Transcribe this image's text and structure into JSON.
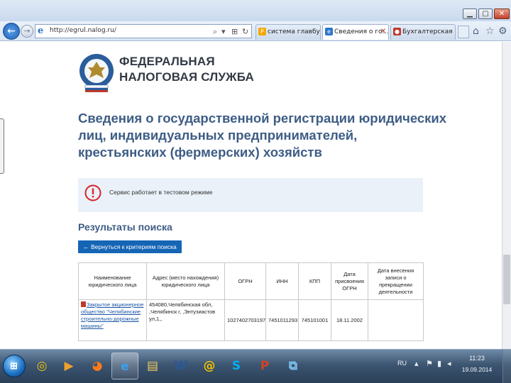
{
  "browser": {
    "window_buttons": {
      "minimize": "▁",
      "maximize": "▢",
      "close": "✕"
    },
    "back_icon": "←",
    "forward_icon": "→",
    "url": "http://egrul.nalog.ru/",
    "address_icons": {
      "search": "⌕",
      "dropdown": "▾",
      "compat": "⊞",
      "refresh": "↻"
    },
    "tabs": [
      {
        "label": "система главбух ...",
        "fav": "P",
        "fav_color": "#f2a900"
      },
      {
        "label": "Сведения о го...",
        "fav": "e",
        "fav_color": "#2a75c9",
        "close": "✕"
      },
      {
        "label": "Бухгалтерская сп...",
        "fav": "●",
        "fav_color": "#c0392b"
      }
    ],
    "command_icons": {
      "home": "⌂",
      "favorites": "☆",
      "tools": "⚙"
    }
  },
  "page": {
    "logo": {
      "line1": "ФЕДЕРАЛЬНАЯ",
      "line2": "НАЛОГОВАЯ СЛУЖБА"
    },
    "title": "Сведения о государственной регистрации юридических лиц, индивидуальных предпринимателей, крестьянских (фермерских) хозяйств",
    "notice": {
      "icon": "!",
      "text": "Сервис работает в тестовом режиме"
    },
    "results_heading": "Результаты поиска",
    "back_button": "← Вернуться к критериям поиска",
    "table": {
      "headers": [
        "Наименование юридического лица",
        "Адрес (место нахождения) юридического лица",
        "ОГРН",
        "ИНН",
        "КПП",
        "Дата присвоения ОГРН",
        "Дата внесения записи о прекращении деятельности"
      ],
      "rows": [
        {
          "name": "Закрытое акционерное общество \"Челябинские строительно-дорожные машины\"",
          "address": "454080,Челябинская обл, ,Челябинск г, ,Энтузиастов ул,1,,",
          "ogrn": "1027402703197",
          "inn": "7451011293",
          "kpp": "745101001",
          "date_ogrn": "18.11.2002",
          "date_end": ""
        }
      ]
    }
  },
  "taskbar": {
    "start_icon": "⊞",
    "apps": [
      {
        "name": "chrome",
        "glyph": "◎",
        "color": "#f4c20d"
      },
      {
        "name": "media",
        "glyph": "▶",
        "color": "#f0a030"
      },
      {
        "name": "firefox",
        "glyph": "◕",
        "color": "#ff7a1a"
      },
      {
        "name": "ie",
        "glyph": "e",
        "color": "#3aa0ef",
        "active": true
      },
      {
        "name": "explorer",
        "glyph": "▤",
        "color": "#f3cf5a"
      },
      {
        "name": "word",
        "glyph": "W",
        "color": "#2b5797"
      },
      {
        "name": "mail",
        "glyph": "@",
        "color": "#f0c000"
      },
      {
        "name": "skype",
        "glyph": "S",
        "color": "#00aff0"
      },
      {
        "name": "powerpoint",
        "glyph": "P",
        "color": "#d04423"
      },
      {
        "name": "network",
        "glyph": "⧉",
        "color": "#7cc3f0"
      }
    ],
    "lang": "RU",
    "tray_icons": {
      "arrow": "▴",
      "flag": "⚑",
      "network": "▮",
      "volume": "◂"
    },
    "time": "11:23",
    "date": "19.09.2014"
  }
}
